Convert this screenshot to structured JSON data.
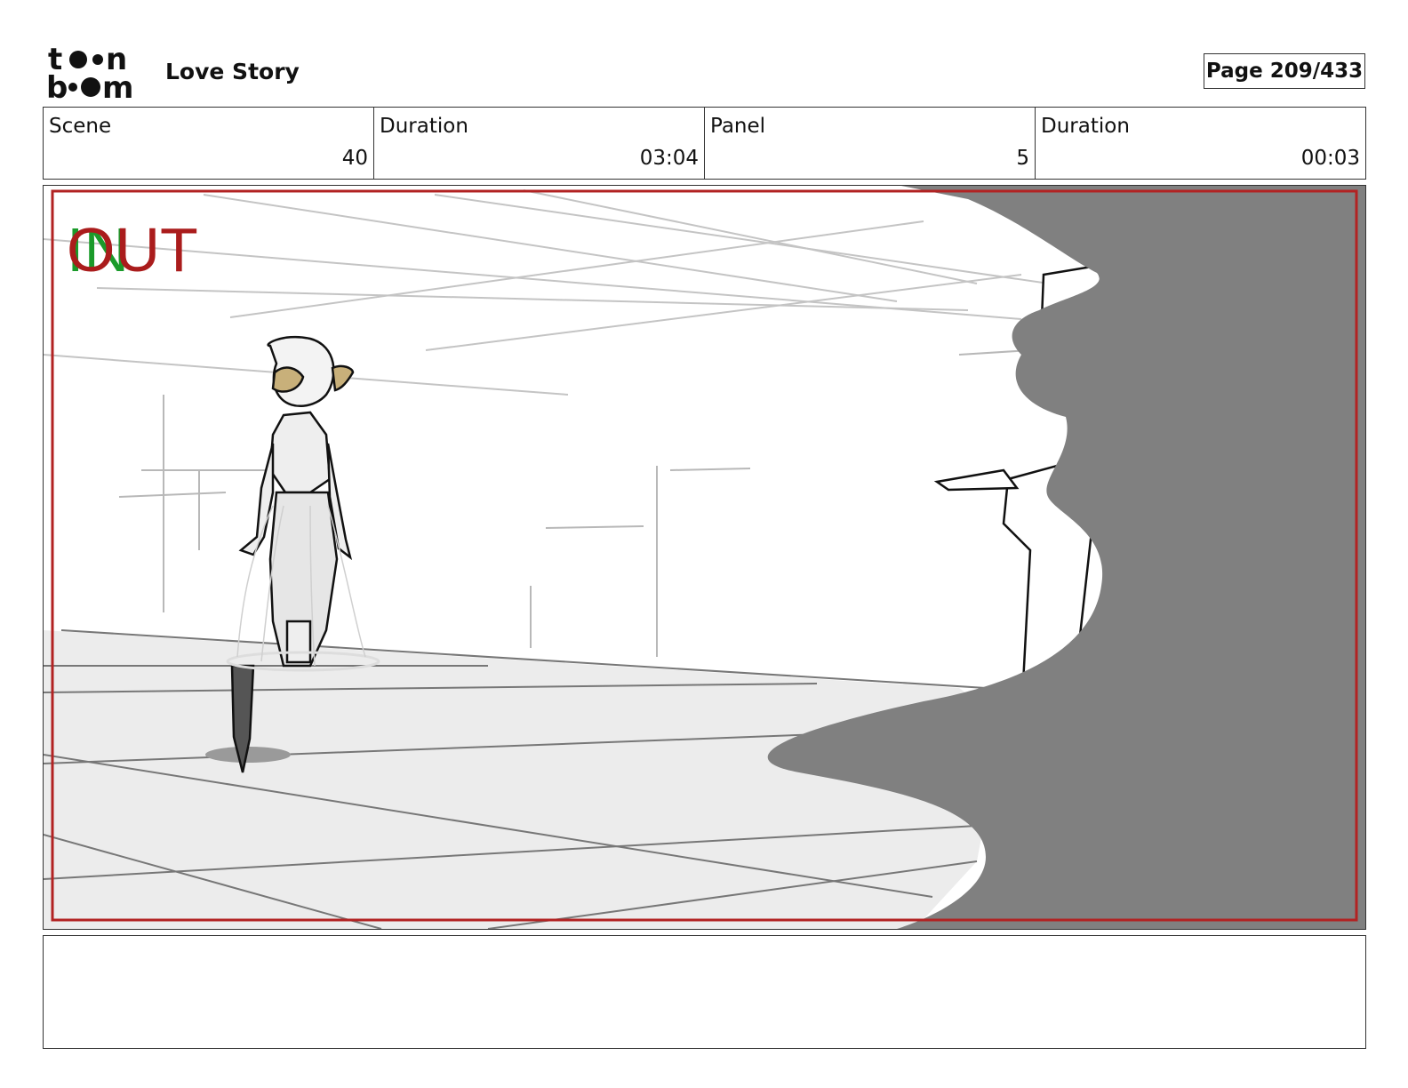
{
  "header": {
    "logo_text": "toon boom",
    "project_title": "Love Story",
    "page_indicator": "Page 209/433"
  },
  "info": {
    "scene_label": "Scene",
    "scene_value": "40",
    "scene_duration_label": "Duration",
    "scene_duration_value": "03:04",
    "panel_label": "Panel",
    "panel_value": "5",
    "panel_duration_label": "Duration",
    "panel_duration_value": "00:03"
  },
  "panel": {
    "in_marker": "IN",
    "out_marker": "OUT",
    "colors": {
      "in": "#1a9a2a",
      "out": "#aa1c1c",
      "safe_frame": "#b22222",
      "foreground_shape": "#808080",
      "floor": "#ececec"
    }
  },
  "notes": {
    "text": ""
  }
}
